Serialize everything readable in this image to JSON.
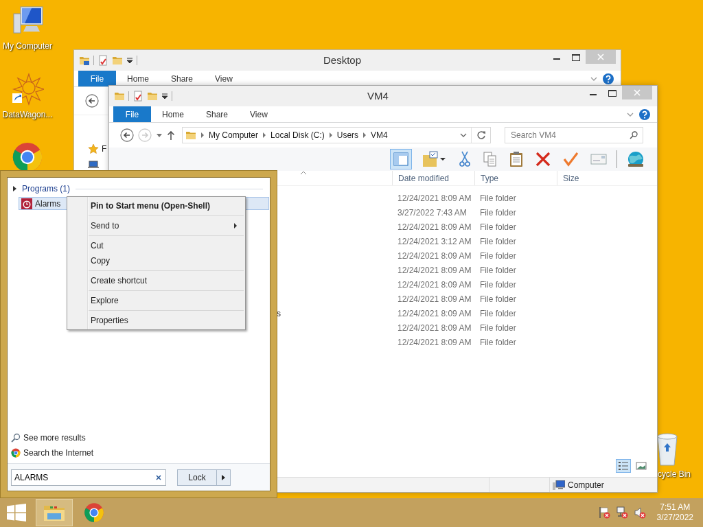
{
  "desktop_icons": [
    {
      "kind": "computer",
      "label": "My Computer"
    },
    {
      "kind": "app_shortcut",
      "label": "DataWagon..."
    },
    {
      "kind": "chrome"
    }
  ],
  "recycle_bin": {
    "label": "cycle Bin"
  },
  "desktop_window": {
    "title": "Desktop",
    "file_tab": "File",
    "tabs": [
      "Home",
      "Share",
      "View"
    ],
    "nav_pane": [
      {
        "kind": "favorites",
        "label": "F"
      },
      {
        "kind": "computer"
      }
    ]
  },
  "explorer_window": {
    "title": "VM4",
    "file_tab": "File",
    "tabs": [
      "Home",
      "Share",
      "View"
    ],
    "breadcrumb": [
      "My Computer",
      "Local Disk (C:)",
      "Users",
      "VM4"
    ],
    "search": {
      "placeholder": "Search VM4"
    },
    "toolbar": [
      {
        "kind": "preview_pane",
        "selected": true
      },
      {
        "kind": "folder_options",
        "selected": false
      },
      {
        "kind": "cut",
        "selected": false
      },
      {
        "kind": "copy",
        "selected": false
      },
      {
        "kind": "paste",
        "selected": false
      },
      {
        "kind": "delete",
        "selected": false
      },
      {
        "kind": "check",
        "selected": false
      },
      {
        "kind": "mail",
        "selected": false
      },
      {
        "kind": "globe",
        "selected": false
      }
    ],
    "columns": [
      "Date modified",
      "Type",
      "Size"
    ],
    "rows": [
      {
        "date": "12/24/2021 8:09 AM",
        "type": "File folder"
      },
      {
        "date": "3/27/2022 7:43 AM",
        "type": "File folder"
      },
      {
        "date": "12/24/2021 8:09 AM",
        "type": "File folder"
      },
      {
        "date": "12/24/2021 3:12 AM",
        "type": "File folder"
      },
      {
        "date": "12/24/2021 8:09 AM",
        "type": "File folder"
      },
      {
        "date": "12/24/2021 8:09 AM",
        "type": "File folder"
      },
      {
        "date": "12/24/2021 8:09 AM",
        "type": "File folder"
      },
      {
        "date": "12/24/2021 8:09 AM",
        "type": "File folder"
      },
      {
        "name": "s",
        "date": "12/24/2021 8:09 AM",
        "type": "File folder"
      },
      {
        "date": "12/24/2021 8:09 AM",
        "type": "File folder"
      },
      {
        "date": "12/24/2021 8:09 AM",
        "type": "File folder"
      }
    ],
    "view_buttons": [
      {
        "kind": "details",
        "selected": true
      },
      {
        "kind": "large_icons",
        "selected": false
      }
    ],
    "status_bar": {
      "location": "Computer"
    }
  },
  "start_menu": {
    "group": "Programs (1)",
    "results": [
      {
        "kind": "alarm",
        "label": "Alarms",
        "selected": true
      }
    ],
    "links": [
      {
        "kind": "search",
        "label": "See more results"
      },
      {
        "kind": "chrome",
        "label": "Search the Internet"
      }
    ],
    "search_field": {
      "value": "ALARMS"
    },
    "power_button": "Lock"
  },
  "context_menu": {
    "groups": [
      [
        {
          "label": "Pin to Start menu (Open-Shell)",
          "default": true,
          "submenu": false
        }
      ],
      [
        {
          "label": "Send to",
          "default": false,
          "submenu": true
        }
      ],
      [
        {
          "label": "Cut",
          "default": false,
          "submenu": false
        },
        {
          "label": "Copy",
          "default": false,
          "submenu": false
        }
      ],
      [
        {
          "label": "Create shortcut",
          "default": false,
          "submenu": false
        }
      ],
      [
        {
          "label": "Explore",
          "default": false,
          "submenu": false
        }
      ],
      [
        {
          "label": "Properties",
          "default": false,
          "submenu": false
        }
      ]
    ]
  },
  "taskbar": {
    "apps": [
      {
        "kind": "file_explorer",
        "selected": true
      },
      {
        "kind": "chrome",
        "selected": false
      }
    ],
    "clock": {
      "time": "7:51 AM",
      "date": "3/27/2022"
    }
  }
}
